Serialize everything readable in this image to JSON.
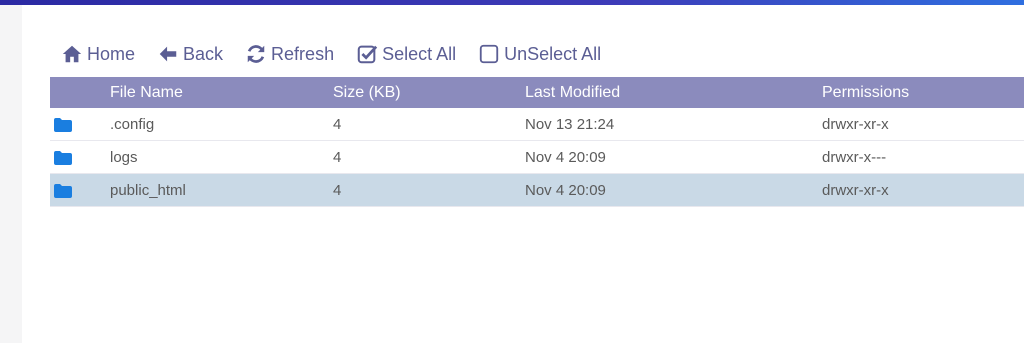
{
  "toolbar": {
    "home": "Home",
    "back": "Back",
    "refresh": "Refresh",
    "select_all": "Select All",
    "unselect_all": "UnSelect All"
  },
  "table": {
    "headers": {
      "name": "File Name",
      "size": "Size (KB)",
      "modified": "Last Modified",
      "permissions": "Permissions"
    },
    "rows": [
      {
        "name": ".config",
        "size": "4",
        "modified": "Nov 13 21:24",
        "permissions": "drwxr-xr-x",
        "icon": "folder-icon",
        "selected": false
      },
      {
        "name": "logs",
        "size": "4",
        "modified": "Nov 4 20:09",
        "permissions": "drwxr-x---",
        "icon": "folder-icon",
        "selected": false
      },
      {
        "name": "public_html",
        "size": "4",
        "modified": "Nov 4 20:09",
        "permissions": "drwxr-xr-x",
        "icon": "folder-icon",
        "selected": true
      }
    ]
  },
  "colors": {
    "header_bg": "#8b8bbd",
    "toolbar_text": "#5b5e94",
    "folder": "#1a7ee0",
    "selected_row": "#c9d9e6"
  }
}
